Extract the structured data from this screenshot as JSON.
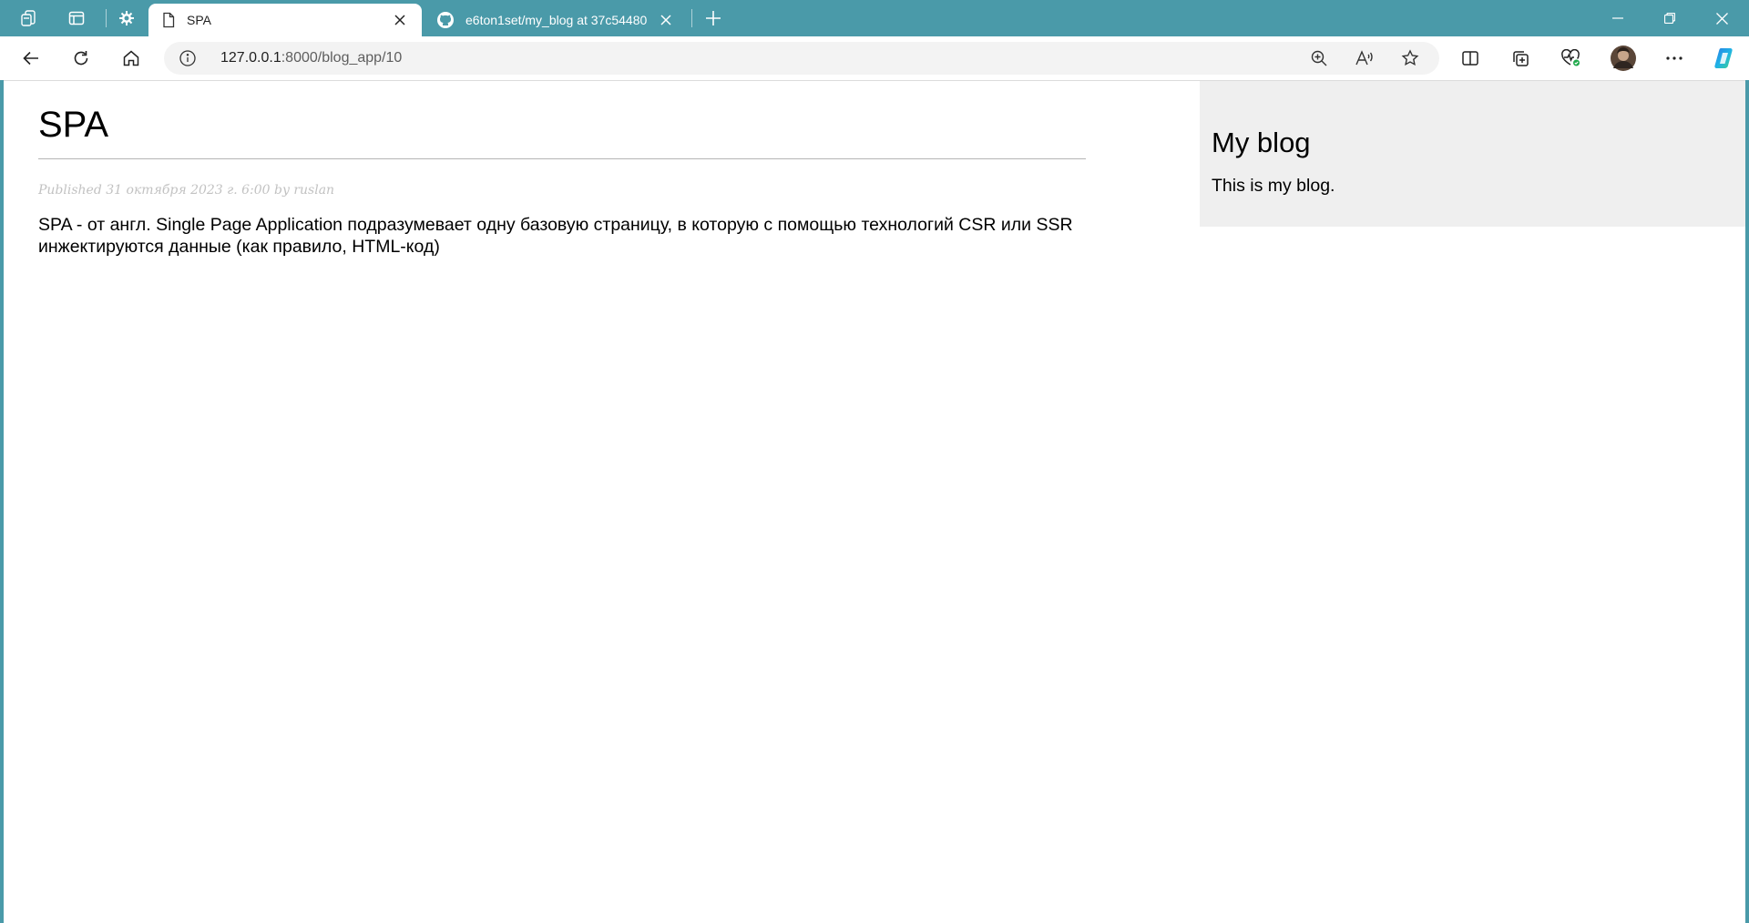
{
  "browser": {
    "tabs": [
      {
        "title": "SPA",
        "active": true
      },
      {
        "title": "e6ton1set/my_blog at 37c54480",
        "active": false
      }
    ],
    "address": {
      "host": "127.0.0.1",
      "rest": ":8000/blog_app/10"
    },
    "strip_icons": [
      "workspaces-icon",
      "tab-actions-icon",
      "extension-icon"
    ],
    "toolbar_icons": [
      "back-icon",
      "refresh-icon",
      "home-icon"
    ],
    "address_icons": [
      "info-icon",
      "zoom-icon",
      "read-aloud-icon",
      "favorite-star-icon"
    ],
    "right_icons": [
      "split-screen-icon",
      "collections-icon",
      "browser-essentials-icon",
      "profile-avatar",
      "more-icon",
      "copilot-icon"
    ],
    "colors": {
      "frame": "#4a9aa9",
      "sidebar_bg": "#efefef"
    }
  },
  "post": {
    "title": "SPA",
    "meta": "Published 31 октября 2023 г. 6:00 by ruslan",
    "body": "SPA - от англ. Single Page Application подразумевает одну базовую страницу, в которую с помощью технологий CSR или SSR инжектируются данные (как правило, HTML-код)"
  },
  "sidebar": {
    "heading": "My blog",
    "text": "This is my blog."
  }
}
